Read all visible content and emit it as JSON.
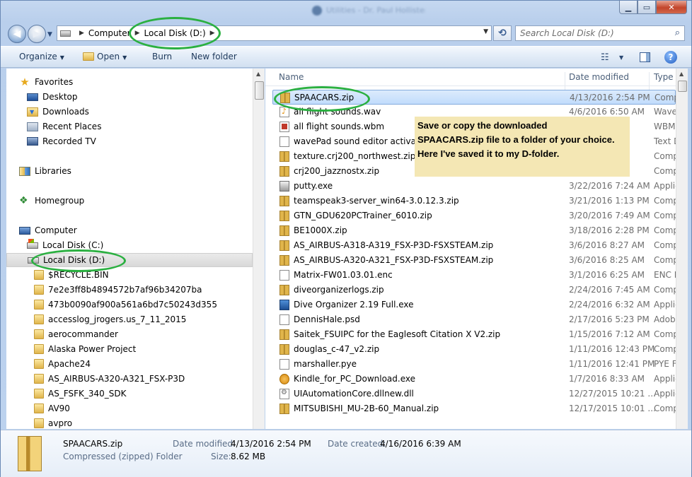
{
  "title_blur": "Utilities - Dr. Paul Hollister",
  "address": {
    "crumbs": [
      "Computer",
      "Local Disk (D:)"
    ],
    "search_placeholder": "Search Local Disk (D:)"
  },
  "toolbar": {
    "organize": "Organize",
    "open": "Open",
    "burn": "Burn",
    "new_folder": "New folder"
  },
  "nav": {
    "favorites": "Favorites",
    "desktop": "Desktop",
    "downloads": "Downloads",
    "recent_places": "Recent Places",
    "recorded_tv": "Recorded TV",
    "libraries": "Libraries",
    "homegroup": "Homegroup",
    "computer": "Computer",
    "disk_c": "Local Disk (C:)",
    "disk_d": "Local Disk (D:)",
    "folders": [
      "$RECYCLE.BIN",
      "7e2e3ff8b4894572b7af96b34207ba",
      "473b0090af900a561a6bd7c50243d355",
      "accesslog_jrogers.us_7_11_2015",
      "aerocommander",
      "Alaska Power Project",
      "Apache24",
      "AS_AIRBUS-A320-A321_FSX-P3D",
      "AS_FSFK_340_SDK",
      "AV90",
      "avpro"
    ]
  },
  "columns": {
    "name": "Name",
    "date": "Date modified",
    "type": "Type"
  },
  "files": [
    {
      "name": "SPAACARS.zip",
      "date": "4/13/2016 2:54 PM",
      "type": "Comp"
    },
    {
      "name": "all flight sounds.wav",
      "date": "4/6/2016 6:50 AM",
      "type": "Wave"
    },
    {
      "name": "all flight sounds.wbm",
      "date": "",
      "type": "WBM"
    },
    {
      "name": "wavePad sound editor activation",
      "date": "",
      "type": "Text D"
    },
    {
      "name": "texture.crj200_northwest.zip",
      "date": "",
      "type": "Comp"
    },
    {
      "name": "crj200_jazznostx.zip",
      "date": "",
      "type": "Comp"
    },
    {
      "name": "putty.exe",
      "date": "3/22/2016 7:24 AM",
      "type": "Applic"
    },
    {
      "name": "teamspeak3-server_win64-3.0.12.3.zip",
      "date": "3/21/2016 1:13 PM",
      "type": "Comp"
    },
    {
      "name": "GTN_GDU620PCTrainer_6010.zip",
      "date": "3/20/2016 7:49 AM",
      "type": "Comp"
    },
    {
      "name": "BE1000X.zip",
      "date": "3/18/2016 2:28 PM",
      "type": "Comp"
    },
    {
      "name": "AS_AIRBUS-A318-A319_FSX-P3D-FSXSTEAM.zip",
      "date": "3/6/2016 8:27 AM",
      "type": "Comp"
    },
    {
      "name": "AS_AIRBUS-A320-A321_FSX-P3D-FSXSTEAM.zip",
      "date": "3/6/2016 8:25 AM",
      "type": "Comp"
    },
    {
      "name": "Matrix-FW01.03.01.enc",
      "date": "3/1/2016 6:25 AM",
      "type": "ENC F"
    },
    {
      "name": "diveorganizerlogs.zip",
      "date": "2/24/2016 7:45 AM",
      "type": "Comp"
    },
    {
      "name": "Dive Organizer 2.19 Full.exe",
      "date": "2/24/2016 6:32 AM",
      "type": "Applic"
    },
    {
      "name": "DennisHale.psd",
      "date": "2/17/2016 5:23 PM",
      "type": "Adob"
    },
    {
      "name": "Saitek_FSUIPC for the Eaglesoft Citation X V2.zip",
      "date": "1/15/2016 7:12 AM",
      "type": "Comp"
    },
    {
      "name": "douglas_c-47_v2.zip",
      "date": "1/11/2016 12:43 PM",
      "type": "Comp"
    },
    {
      "name": "marshaller.pye",
      "date": "1/11/2016 12:41 PM",
      "type": "PYE F"
    },
    {
      "name": "Kindle_for_PC_Download.exe",
      "date": "1/7/2016 8:33 AM",
      "type": "Applic"
    },
    {
      "name": "UIAutomationCore.dllnew.dll",
      "date": "12/27/2015 10:21 ...",
      "type": "Applic"
    },
    {
      "name": "MITSUBISHI_MU-2B-60_Manual.zip",
      "date": "12/17/2015 10:01 ...",
      "type": "Comp"
    }
  ],
  "note": {
    "line1": "Save or copy the downloaded",
    "line2": "SPAACARS.zip file to a folder of your choice.",
    "line3": "Here I've saved it to my D-folder."
  },
  "details": {
    "filename": "SPAACARS.zip",
    "kind": "Compressed (zipped) Folder",
    "modified_label": "Date modified:",
    "modified_value": "4/13/2016 2:54 PM",
    "created_label": "Date created:",
    "created_value": "4/16/2016 6:39 AM",
    "size_label": "Size:",
    "size_value": "8.62 MB"
  },
  "colors": {
    "annotation_oval": "#2bb041",
    "note_bg": "#f4e7b4",
    "selection": "#c1dcfc"
  }
}
